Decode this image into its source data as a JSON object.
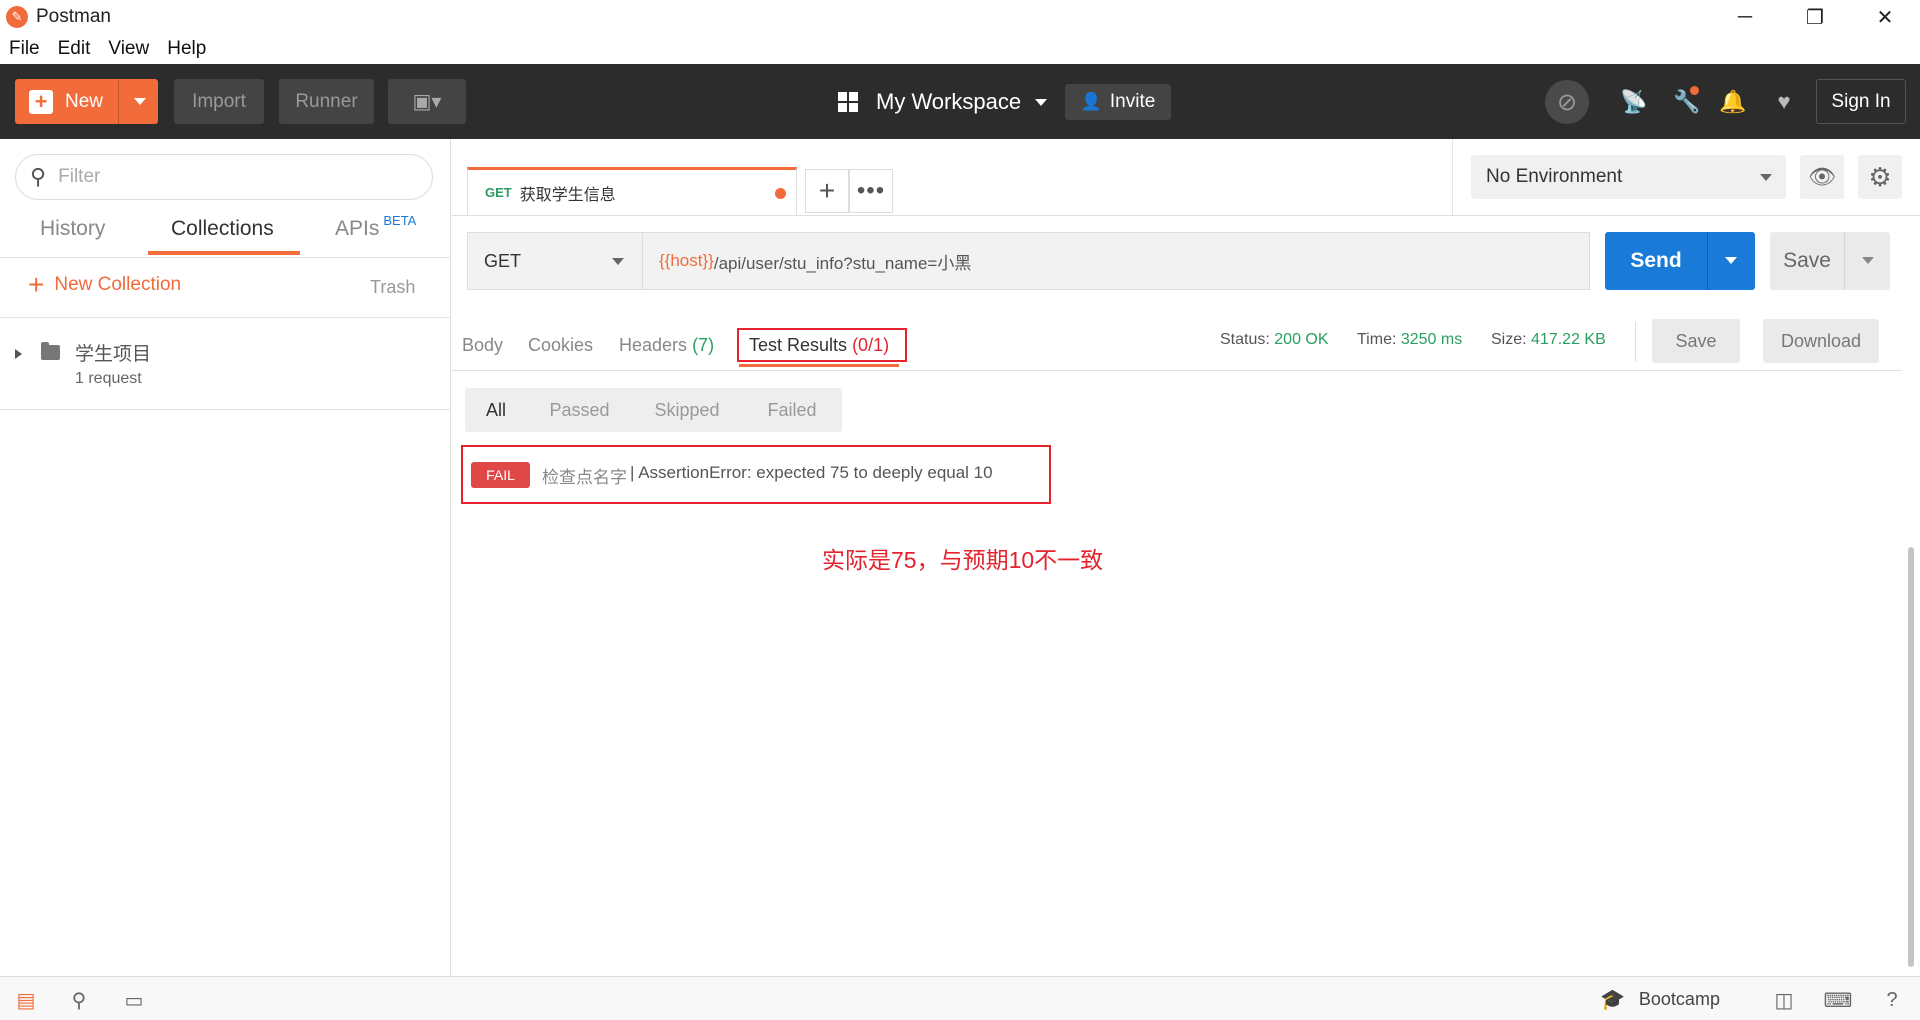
{
  "window": {
    "title": "Postman",
    "controls": [
      "─",
      "❐",
      "✕"
    ]
  },
  "menu": [
    "File",
    "Edit",
    "View",
    "Help"
  ],
  "header": {
    "new_label": "New",
    "import_label": "Import",
    "runner_label": "Runner",
    "workspace_label": "My Workspace",
    "invite_label": "Invite",
    "signin_label": "Sign In"
  },
  "sidebar": {
    "filter_placeholder": "Filter",
    "tabs": {
      "history": "History",
      "collections": "Collections",
      "apis": "APIs",
      "beta": "BETA"
    },
    "new_collection": "New Collection",
    "trash": "Trash",
    "collections": [
      {
        "name": "学生项目",
        "count": "1 request"
      }
    ]
  },
  "request_tab": {
    "method": "GET",
    "name": "获取学生信息"
  },
  "environment": {
    "selected": "No Environment"
  },
  "request": {
    "method": "GET",
    "url_var": "{{host}}",
    "url_rest": "/api/user/stu_info?stu_name=小黑",
    "send_label": "Send",
    "save_label": "Save"
  },
  "response": {
    "tabs": {
      "body": "Body",
      "cookies": "Cookies",
      "headers": "Headers",
      "headers_count": "(7)",
      "tests": "Test Results",
      "tests_count": "(0/1)"
    },
    "status_label": "Status:",
    "status_value": "200 OK",
    "time_label": "Time:",
    "time_value": "3250 ms",
    "size_label": "Size:",
    "size_value": "417.22 KB",
    "save_label": "Save",
    "download_label": "Download"
  },
  "test_filters": [
    "All",
    "Passed",
    "Skipped",
    "Failed"
  ],
  "test_result": {
    "badge": "FAIL",
    "name": "检查点名字",
    "message": "| AssertionError: expected 75 to deeply equal 10"
  },
  "annotation": "实际是75，与预期10不一致",
  "footer": {
    "bootcamp": "Bootcamp"
  },
  "colors": {
    "accent": "#f26b3a",
    "send": "#1a7ad8",
    "success": "#2a9e62",
    "error": "#e5222d"
  }
}
